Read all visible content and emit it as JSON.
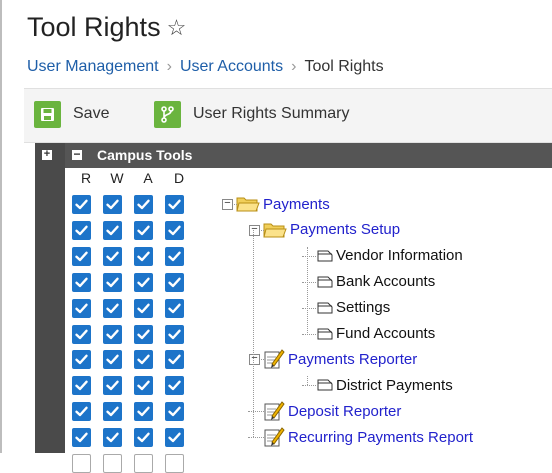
{
  "page": {
    "title": "Tool Rights",
    "breadcrumb": [
      "User Management",
      "User Accounts",
      "Tool Rights"
    ]
  },
  "toolbar": {
    "save_label": "Save",
    "summary_label": "User Rights Summary"
  },
  "tree": {
    "expand_all": "+",
    "collapse": "−",
    "root_label": "Campus Tools",
    "rights_headers": [
      "R",
      "W",
      "A",
      "D"
    ],
    "nodes": [
      {
        "label": "Payments",
        "kind": "folder-open",
        "link": true
      },
      {
        "label": "Payments Setup",
        "kind": "folder-open",
        "link": true
      },
      {
        "label": "Vendor Information",
        "kind": "page",
        "link": false
      },
      {
        "label": "Bank Accounts",
        "kind": "page",
        "link": false
      },
      {
        "label": "Settings",
        "kind": "page",
        "link": false
      },
      {
        "label": "Fund Accounts",
        "kind": "page",
        "link": false
      },
      {
        "label": "Payments Reporter",
        "kind": "report",
        "link": true
      },
      {
        "label": "District Payments",
        "kind": "page",
        "link": false
      },
      {
        "label": "Deposit Reporter",
        "kind": "report",
        "link": true
      },
      {
        "label": "Recurring Payments Report",
        "kind": "report",
        "link": true
      }
    ]
  },
  "colors": {
    "accent_green": "#6ab43e",
    "checkbox_blue": "#1d74c9",
    "link_blue": "#2222cc",
    "header_gray": "#555555"
  }
}
